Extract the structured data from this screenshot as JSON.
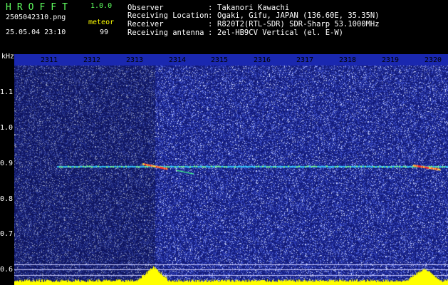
{
  "header": {
    "title": "HROFFT",
    "version": "1.0.0",
    "filename": "2505042310.png",
    "meteor_label": "meteor",
    "datetime": "25.05.04 23:10",
    "meteor_count": "99",
    "info": [
      {
        "label": "Observer",
        "value": "Takanori Kawachi"
      },
      {
        "label": "Receiving Location",
        "value": "Ogaki, Gifu, JAPAN (136.60E, 35.35N)"
      },
      {
        "label": "Receiver",
        "value": "R820T2(RTL-SDR) SDR-Sharp 53.1000MHz"
      },
      {
        "label": "Receiving antenna",
        "value": "2el-HB9CV Vertical (el. E-W)"
      }
    ]
  },
  "spectrogram": {
    "y_unit": "kHz",
    "x_ticks": [
      "2311",
      "2312",
      "2313",
      "2314",
      "2315",
      "2316",
      "2317",
      "2318",
      "2319",
      "2320"
    ],
    "y_ticks": [
      "1.1",
      "1.0",
      "0.9",
      "0.8",
      "0.7",
      "0.6"
    ],
    "y_values": [
      1.1,
      1.0,
      0.9,
      0.8,
      0.7,
      0.6
    ],
    "y_range": [
      0.585,
      1.2
    ],
    "carrier_khz": 0.9,
    "colors": {
      "background": "#1c2aa0",
      "carrier": "#40e0ff",
      "meteor": "#ff3030",
      "axis_text_bg": "#1520a0",
      "baseline": "#ffff00"
    }
  }
}
